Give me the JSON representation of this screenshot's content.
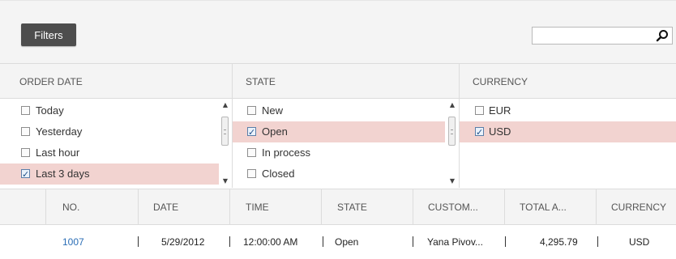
{
  "toolbar": {
    "filters_label": "Filters",
    "search_value": "",
    "search_placeholder": "",
    "search_icon": "search-icon"
  },
  "filter_headers": {
    "order_date": "ORDER DATE",
    "state": "STATE",
    "currency": "CURRENCY"
  },
  "order_date_options": [
    {
      "label": "Today",
      "checked": false
    },
    {
      "label": "Yesterday",
      "checked": false
    },
    {
      "label": "Last hour",
      "checked": false
    },
    {
      "label": "Last 3 days",
      "checked": true
    }
  ],
  "state_options": [
    {
      "label": "New",
      "checked": false
    },
    {
      "label": "Open",
      "checked": true
    },
    {
      "label": "In process",
      "checked": false
    },
    {
      "label": "Closed",
      "checked": false
    }
  ],
  "currency_options": [
    {
      "label": "EUR",
      "checked": false
    },
    {
      "label": "USD",
      "checked": true
    }
  ],
  "grid": {
    "columns": [
      "NO.",
      "DATE",
      "TIME",
      "STATE",
      "CUSTOM...",
      "TOTAL A...",
      "CURRENCY"
    ],
    "rows": [
      [
        "1007",
        "5/29/2012",
        "12:00:00 AM",
        "Open",
        "Yana Pivov...",
        "4,295.79",
        "USD"
      ]
    ]
  },
  "colors": {
    "selected_row": "#f2d3d0",
    "link": "#2a6db5",
    "button_bg": "#4d4d4d",
    "header_bg": "#f4f4f4"
  }
}
